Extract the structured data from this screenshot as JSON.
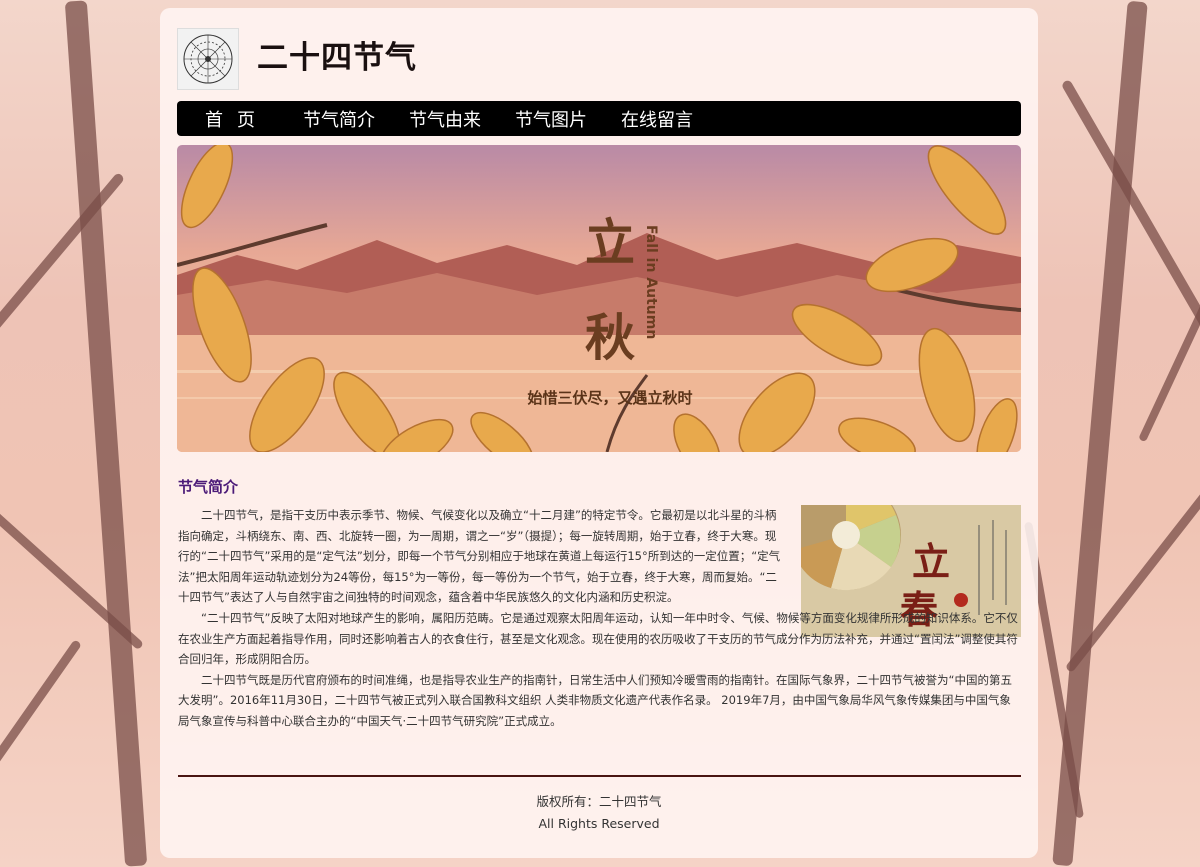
{
  "site": {
    "title": "二十四节气"
  },
  "nav": {
    "items": [
      {
        "label": "首页"
      },
      {
        "label": "节气简介"
      },
      {
        "label": "节气由来"
      },
      {
        "label": "节气图片"
      },
      {
        "label": "在线留言"
      }
    ]
  },
  "banner": {
    "title_top": "立",
    "title_bottom": "秋",
    "subtitle_en": "Fall in Autumn",
    "caption": "始惜三伏尽，又遇立秋时"
  },
  "side_image": {
    "title_top": "立",
    "title_bottom": "春"
  },
  "intro": {
    "heading": "节气简介",
    "paragraphs": [
      "二十四节气，是指干支历中表示季节、物候、气候变化以及确立“十二月建”的特定节令。它最初是以北斗星的斗柄指向确定，斗柄绕东、南、西、北旋转一圈，为一周期，谓之一“岁”（摄提）；每一旋转周期，始于立春，终于大寒。现行的“二十四节气”采用的是“定气法”划分，即每一个节气分别相应于地球在黄道上每运行15°所到达的一定位置；“定气法”把太阳周年运动轨迹划分为24等份，每15°为一等份，每一等份为一个节气，始于立春，终于大寒，周而复始。“二十四节气”表达了人与自然宇宙之间独特的时间观念，蕴含着中华民族悠久的文化内涵和历史积淀。",
      "“二十四节气”反映了太阳对地球产生的影响，属阳历范畴。它是通过观察太阳周年运动，认知一年中时令、气候、物候等方面变化规律所形成的知识体系。它不仅在农业生产方面起着指导作用，同时还影响着古人的衣食住行，甚至是文化观念。现在使用的农历吸收了干支历的节气成分作为历法补充，并通过“置闰法”调整使其符合回归年，形成阴阳合历。",
      "二十四节气既是历代官府颁布的时间准绳，也是指导农业生产的指南针，日常生活中人们预知冷暖雪雨的指南针。在国际气象界，二十四节气被誉为“中国的第五大发明”。2016年11月30日，二十四节气被正式列入联合国教科文组织 人类非物质文化遗产代表作名录。 2019年7月，由中国气象局华风气象传媒集团与中国气象局气象宣传与科普中心联合主办的“中国天气·二十四节气研究院”正式成立。"
    ]
  },
  "footer": {
    "copyright": "版权所有：二十四节气",
    "rights": "All Rights Reserved"
  },
  "colors": {
    "nav_bg": "#000000",
    "section_title": "#4b1a78",
    "divider": "#4a1512"
  }
}
